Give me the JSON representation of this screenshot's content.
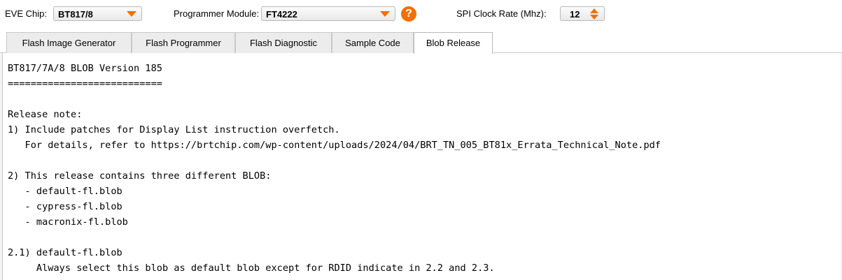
{
  "controls": {
    "eve_chip_label": "EVE Chip:",
    "eve_chip_value": "BT817/8",
    "programmer_label": "Programmer Module:",
    "programmer_value": "FT4222",
    "help_glyph": "?",
    "spi_label": "SPI Clock Rate (Mhz):",
    "spi_value": "12"
  },
  "tabs": [
    {
      "label": "Flash Image Generator",
      "active": false
    },
    {
      "label": "Flash Programmer",
      "active": false
    },
    {
      "label": "Flash Diagnostic",
      "active": false
    },
    {
      "label": "Sample Code",
      "active": false
    },
    {
      "label": "Blob Release",
      "active": true
    }
  ],
  "release_notes": {
    "lines": [
      "BT817/7A/8 BLOB Version 185",
      "===========================",
      "",
      "Release note:",
      "1) Include patches for Display List instruction overfetch.",
      "   For details, refer to https://brtchip.com/wp-content/uploads/2024/04/BRT_TN_005_BT81x_Errata_Technical_Note.pdf",
      "",
      "2) This release contains three different BLOB:",
      "   - default-fl.blob",
      "   - cypress-fl.blob",
      "   - macronix-fl.blob",
      "",
      "2.1) default-fl.blob",
      "     Always select this blob as default blob except for RDID indicate in 2.2 and 2.3."
    ]
  },
  "colors": {
    "accent": "#f07000",
    "tab_inactive": "#ececec",
    "border": "#c9c9c9"
  },
  "icons": {
    "help": "help-icon",
    "combo_arrow": "chevron-down-icon",
    "spin": "spin-up-down-icon"
  }
}
